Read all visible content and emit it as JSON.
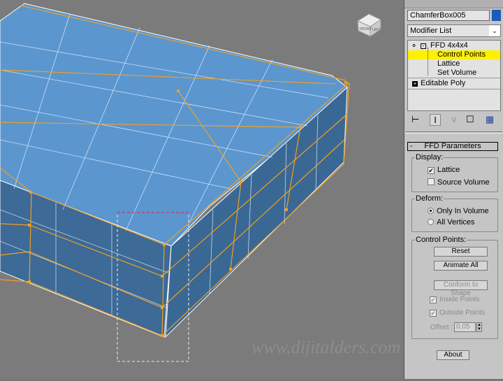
{
  "object_name": "ChamferBox005",
  "object_color": "#1d5bbb",
  "modifier_list": "Modifier List",
  "stack": {
    "modifier": "FFD 4x4x4",
    "sub": [
      "Control Points",
      "Lattice",
      "Set Volume"
    ],
    "selected": "Control Points",
    "base": "Editable Poly"
  },
  "rollout": {
    "title": "FFD Parameters",
    "display": {
      "label": "Display:",
      "lattice": "Lattice",
      "lattice_checked": true,
      "source_volume": "Source Volume",
      "source_checked": false
    },
    "deform": {
      "label": "Deform:",
      "only_in_volume": "Only In Volume",
      "all_vertices": "All Vertices",
      "selected": "Only In Volume"
    },
    "control_points": {
      "label": "Control Points:",
      "reset": "Reset",
      "animate_all": "Animate All",
      "conform": "Conform to Shape",
      "inside": "Inside Points",
      "outside": "Outside Points",
      "offset_label": "Offset :",
      "offset": "0,05"
    },
    "about": "About"
  },
  "viewcube": {
    "front": "FRONT",
    "left": "LEFT"
  },
  "watermark": "www.dijitalders.com",
  "colors": {
    "mesh": "#5b94cc",
    "lattice": "#f0a020",
    "highlight": "#ffef00"
  }
}
